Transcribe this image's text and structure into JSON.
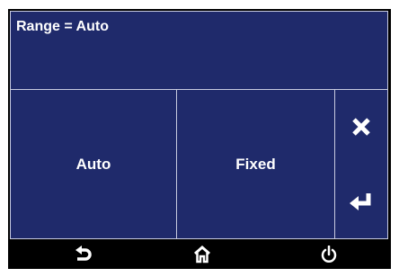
{
  "display": {
    "text": "Range = Auto"
  },
  "options": [
    {
      "label": "Auto"
    },
    {
      "label": "Fixed"
    }
  ],
  "side_buttons": {
    "cancel_icon": "close-icon",
    "enter_icon": "enter-return-icon"
  },
  "nav_bar": {
    "back_icon": "back-arrow-icon",
    "home_icon": "home-icon",
    "power_icon": "power-icon"
  },
  "colors": {
    "panel": "#1f2a6b",
    "border": "#c8cbe0",
    "text": "#ffffff",
    "bar": "#000000"
  }
}
